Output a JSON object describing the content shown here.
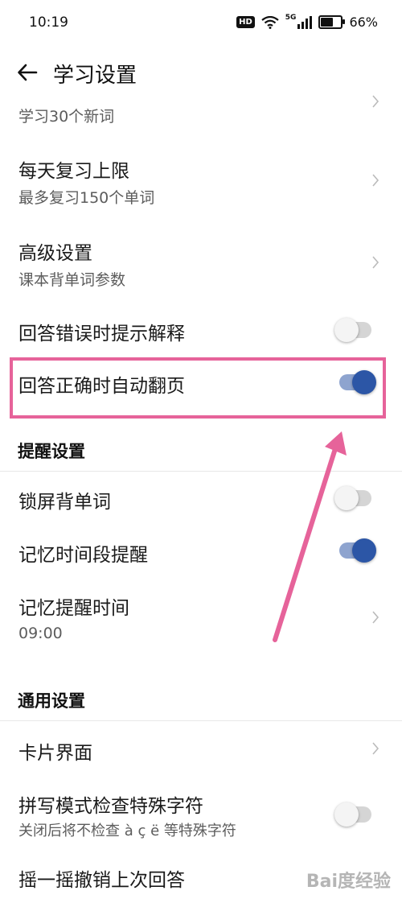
{
  "status_bar": {
    "time": "10:19",
    "network": "5G",
    "battery_percent": "66%",
    "battery_level": 0.66,
    "hd_label": "HD"
  },
  "header": {
    "title": "学习设置"
  },
  "items": {
    "partial": {
      "subtitle": "学习30个新词"
    },
    "daily_review": {
      "title": "每天复习上限",
      "subtitle": "最多复习150个单词"
    },
    "advanced": {
      "title": "高级设置",
      "subtitle": "课本背单词参数"
    },
    "wrong_hint": {
      "title": "回答错误时提示解释",
      "on": false
    },
    "auto_flip": {
      "title": "回答正确时自动翻页",
      "on": true
    },
    "lockscreen": {
      "title": "锁屏背单词",
      "on": false
    },
    "memory_period": {
      "title": "记忆时间段提醒",
      "on": true
    },
    "reminder_time": {
      "title": "记忆提醒时间",
      "subtitle": "09:00"
    },
    "card_ui": {
      "title": "卡片界面"
    },
    "spelling": {
      "title": "拼写模式检查特殊字符",
      "subtitle": "关闭后将不检查 à ç ë 等特殊字符",
      "on": false
    },
    "shake_undo": {
      "title": "摇一摇撤销上次回答"
    }
  },
  "sections": {
    "reminder": "提醒设置",
    "general": "通用设置"
  },
  "watermark": "Bai度经验",
  "colors": {
    "toggle_on": "#2c56a6",
    "annotation": "#e6639a"
  }
}
